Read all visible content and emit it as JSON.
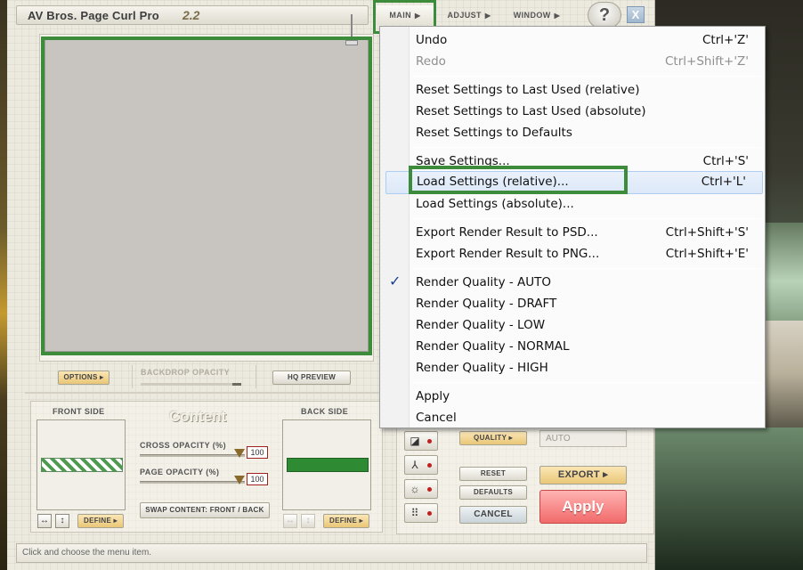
{
  "app": {
    "name": "AV Bros. Page Curl Pro",
    "version": "2.2"
  },
  "topmenu": {
    "main": "MAIN",
    "adjust": "ADJUST",
    "window": "WINDOW",
    "help": "?",
    "close": "X",
    "arrow": "▶"
  },
  "preview_bar": {
    "options": "OPTIONS ▸",
    "backdrop_opacity": "BACKDROP OPACITY",
    "hq_preview": "HQ PREVIEW"
  },
  "content": {
    "title": "Content",
    "front_side": "FRONT SIDE",
    "back_side": "BACK SIDE",
    "cross_opacity_label": "CROSS OPACITY (%)",
    "cross_opacity_value": "100",
    "page_opacity_label": "PAGE OPACITY (%)",
    "page_opacity_value": "100",
    "swap_button": "SWAP CONTENT: FRONT / BACK",
    "define_front": "DEFINE ▸",
    "define_back": "DEFINE ▸"
  },
  "controls": {
    "quality": "QUALITY ▸",
    "quality_value": "AUTO",
    "reset": "RESET",
    "defaults": "DEFAULTS",
    "cancel": "CANCEL",
    "export": "EXPORT ▸",
    "apply": "Apply"
  },
  "status": {
    "text": "Click and choose the menu item."
  },
  "menu": {
    "items": [
      {
        "label": "Undo",
        "shortcut": "Ctrl+'Z'"
      },
      {
        "label": "Redo",
        "shortcut": "Ctrl+Shift+'Z'"
      },
      {
        "label": "Reset Settings to Last Used (relative)",
        "shortcut": ""
      },
      {
        "label": "Reset Settings to Last Used (absolute)",
        "shortcut": ""
      },
      {
        "label": "Reset Settings to Defaults",
        "shortcut": ""
      },
      {
        "label": "Save Settings...",
        "shortcut": "Ctrl+'S'"
      },
      {
        "label": "Load Settings (relative)...",
        "shortcut": "Ctrl+'L'"
      },
      {
        "label": "Load Settings (absolute)...",
        "shortcut": ""
      },
      {
        "label": "Export Render Result to PSD...",
        "shortcut": "Ctrl+Shift+'S'"
      },
      {
        "label": "Export Render Result to PNG...",
        "shortcut": "Ctrl+Shift+'E'"
      },
      {
        "label": "Render Quality - AUTO",
        "shortcut": ""
      },
      {
        "label": "Render Quality - DRAFT",
        "shortcut": ""
      },
      {
        "label": "Render Quality - LOW",
        "shortcut": ""
      },
      {
        "label": "Render Quality - NORMAL",
        "shortcut": ""
      },
      {
        "label": "Render Quality - HIGH",
        "shortcut": ""
      },
      {
        "label": "Apply",
        "shortcut": ""
      },
      {
        "label": "Cancel",
        "shortcut": ""
      }
    ],
    "check_mark": "✓"
  },
  "colors": {
    "highlight_box": "#3c8c3c",
    "apply": "#f26a6a",
    "back_color": "#2f8a34"
  }
}
